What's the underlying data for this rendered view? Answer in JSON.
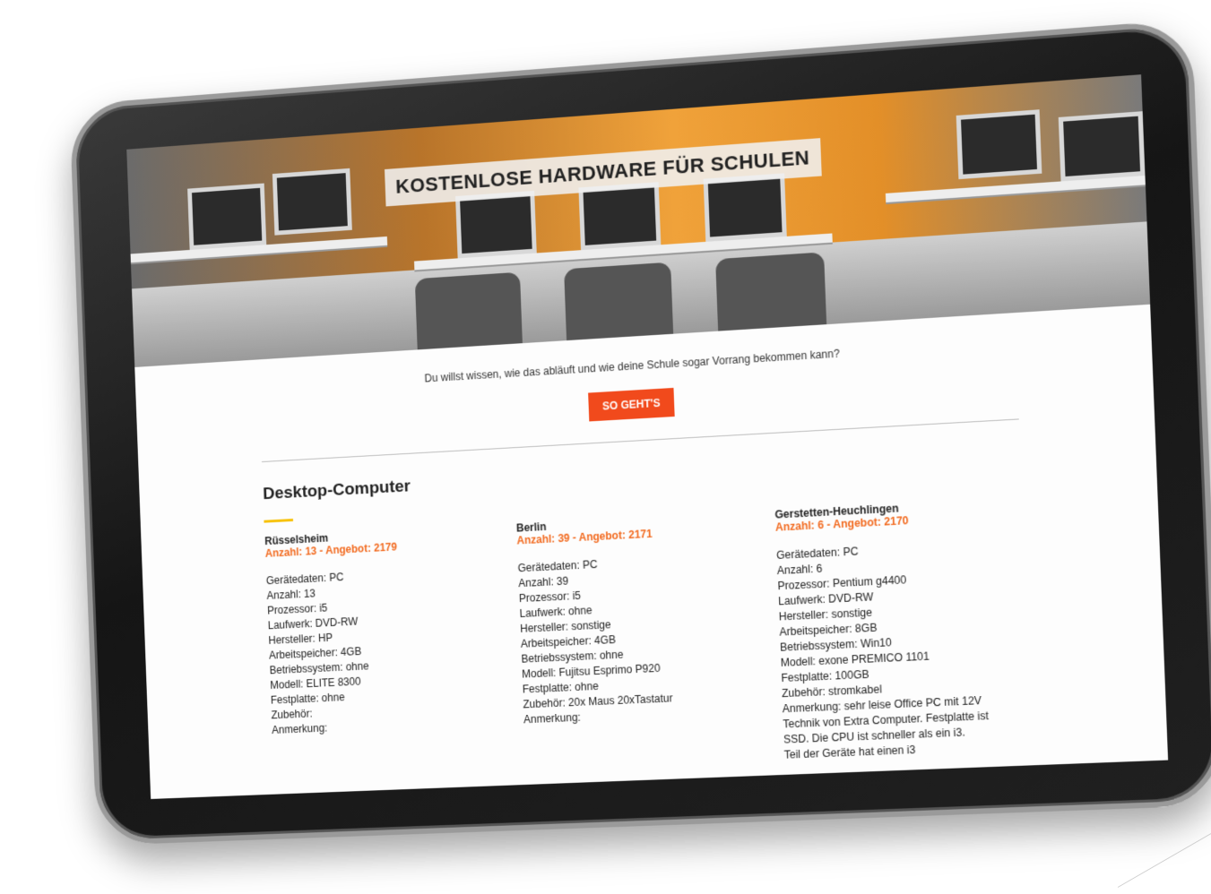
{
  "hero": {
    "title": "KOSTENLOSE HARDWARE FÜR SCHULEN"
  },
  "intro": {
    "text": "Du willst wissen, wie das abläuft und wie deine Schule sogar Vorrang bekommen kann?",
    "button_label": "SO GEHT'S"
  },
  "section": {
    "title": "Desktop-Computer"
  },
  "listings": [
    {
      "location": "Rüsselsheim",
      "offer": "Anzahl: 13 - Angebot: 2179",
      "specs": [
        "Gerätedaten: PC",
        "Anzahl: 13",
        "Prozessor: i5",
        "Laufwerk: DVD-RW",
        "Hersteller: HP",
        "Arbeitspeicher: 4GB",
        "Betriebssystem: ohne",
        "Modell: ELITE 8300",
        "Festplatte: ohne",
        "Zubehör:",
        "Anmerkung:"
      ]
    },
    {
      "location": "Berlin",
      "offer": "Anzahl: 39 - Angebot: 2171",
      "specs": [
        "Gerätedaten: PC",
        "Anzahl: 39",
        "Prozessor: i5",
        "Laufwerk: ohne",
        "Hersteller: sonstige",
        "Arbeitspeicher: 4GB",
        "Betriebssystem: ohne",
        "Modell: Fujitsu Esprimo P920",
        "Festplatte: ohne",
        "Zubehör: 20x Maus 20xTastatur",
        "Anmerkung:"
      ]
    },
    {
      "location": "Gerstetten-Heuchlingen",
      "offer": "Anzahl: 6 - Angebot: 2170",
      "specs": [
        "Gerätedaten: PC",
        "Anzahl: 6",
        "Prozessor: Pentium g4400",
        "Laufwerk: DVD-RW",
        "Hersteller: sonstige",
        "Arbeitspeicher: 8GB",
        "Betriebssystem: Win10",
        "Modell: exone PREMICO 1101",
        "Festplatte: 100GB",
        "Zubehör: stromkabel",
        "Anmerkung: sehr leise Office PC mit 12V",
        "Technik von Extra Computer. Festplatte ist",
        "SSD. Die CPU ist schneller als ein i3.",
        "Teil der Geräte hat einen i3"
      ]
    }
  ],
  "colors": {
    "accent_orange": "#f26a1f",
    "button_red": "#f14a1c",
    "underline_yellow": "#f7c20a"
  }
}
